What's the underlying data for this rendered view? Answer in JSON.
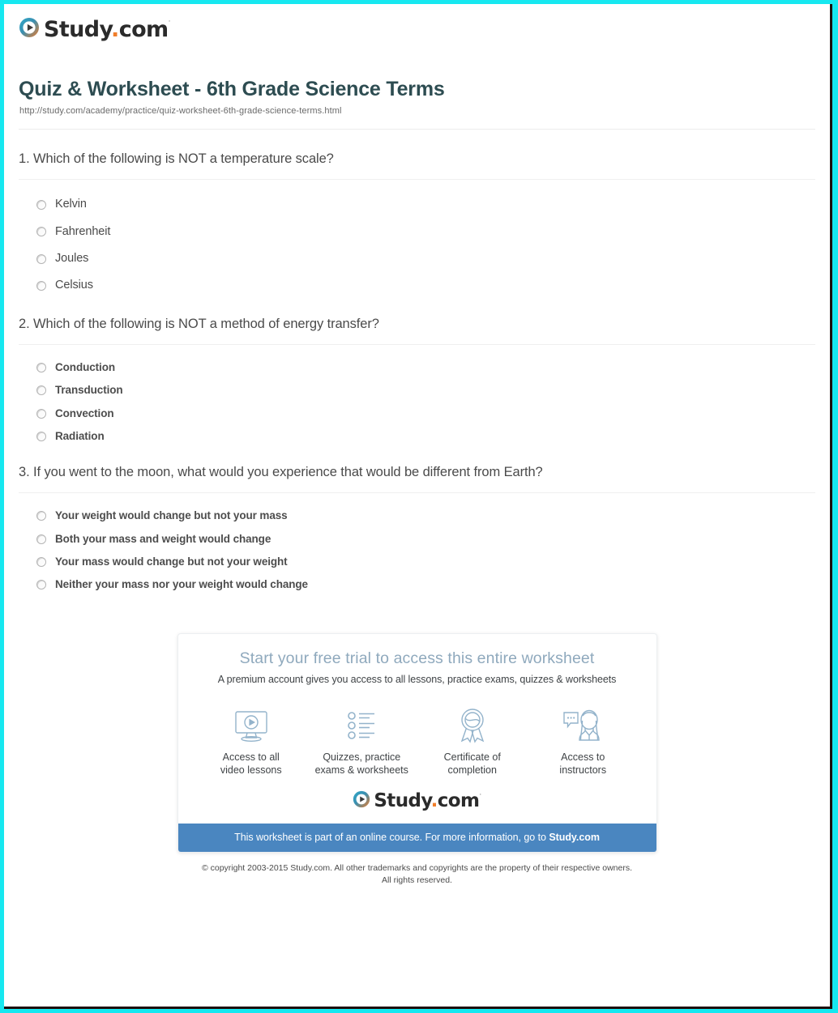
{
  "frame": {
    "border_color": "#16e8f0",
    "inner_edge_color": "#1d100c"
  },
  "brand": {
    "name_part1": "Study",
    "dot": ".",
    "name_part2": "com",
    "trademark": "·",
    "mark_name": "study-com-play-logo",
    "colors": {
      "wordmark": "#2b2b2b",
      "dot": "#f07d2a",
      "ring_teal": "#2aa9c8",
      "ring_orange": "#ef7c2a"
    }
  },
  "header": {
    "title": "Quiz & Worksheet - 6th Grade Science Terms",
    "url": "http://study.com/academy/practice/quiz-worksheet-6th-grade-science-terms.html",
    "title_color": "#2d4c51"
  },
  "questions": [
    {
      "number": "1.",
      "text": "1. Which of the following is NOT a temperature scale?",
      "choices": [
        "Kelvin",
        "Fahrenheit",
        "Joules",
        "Celsius"
      ]
    },
    {
      "number": "2.",
      "text": "2. Which of the following is NOT a method of energy transfer?",
      "choices": [
        "Conduction",
        "Transduction",
        "Convection",
        "Radiation"
      ]
    },
    {
      "number": "3.",
      "text": "3. If you went to the moon, what would you experience that would be different from Earth?",
      "choices": [
        "Your weight would change but not your mass",
        "Both your mass and weight would change",
        "Your mass would change but not your weight",
        "Neither your mass nor your weight would change"
      ]
    }
  ],
  "promo": {
    "headline": "Start your free trial to access this entire worksheet",
    "subhead": "A premium account gives you access to all lessons, practice exams, quizzes & worksheets",
    "headline_color": "#8fa9bd",
    "features": [
      {
        "icon": "video-monitor-icon",
        "line1": "Access to all",
        "line2": "video lessons"
      },
      {
        "icon": "checklist-icon",
        "line1": "Quizzes, practice",
        "line2": "exams & worksheets"
      },
      {
        "icon": "award-ribbon-icon",
        "line1": "Certificate of",
        "line2": "completion"
      },
      {
        "icon": "instructor-chat-icon",
        "line1": "Access to",
        "line2": "instructors"
      }
    ],
    "banner": {
      "text": "This worksheet is part of an online course. For more information, go to ",
      "link": "Study.com",
      "background": "#4a86c0"
    }
  },
  "footer": {
    "line1": "© copyright 2003-2015 Study.com. All other trademarks and copyrights are the property of their respective owners.",
    "line2": "All rights reserved."
  }
}
